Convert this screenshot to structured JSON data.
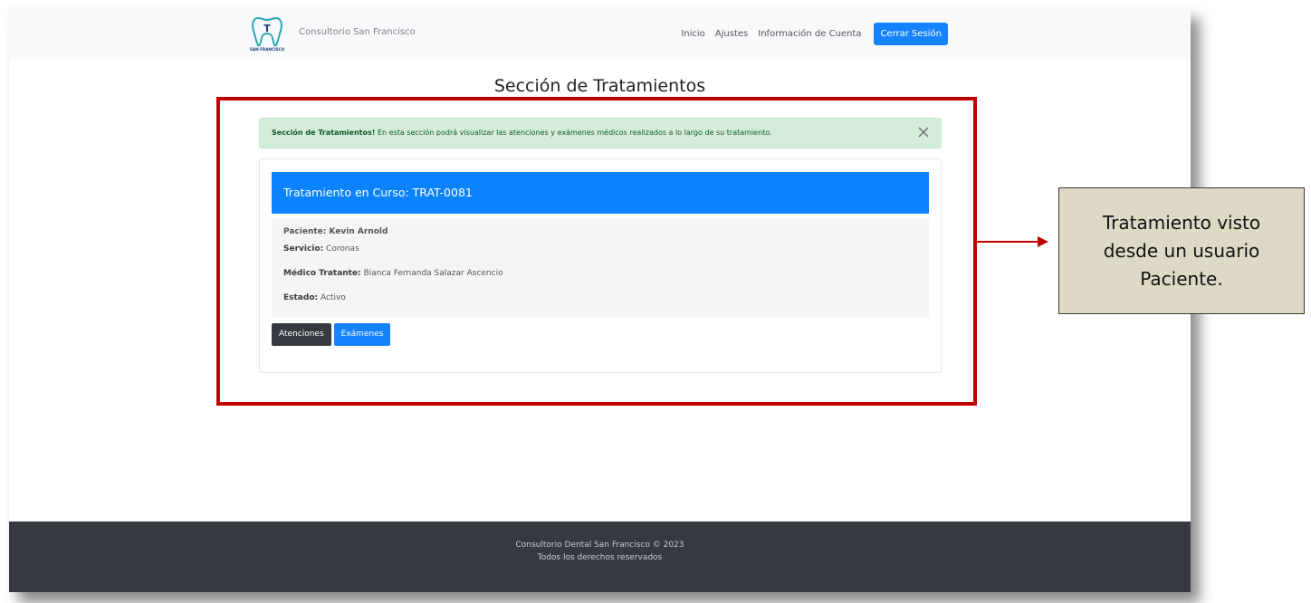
{
  "navbar": {
    "brand_name": "Consultorio San Francisco",
    "logo_text": "SAN FRANCISCO",
    "logo_letter": "T",
    "links": [
      "Inicio",
      "Ajustes",
      "Información de Cuenta"
    ],
    "logout_label": "Cerrar Sesión"
  },
  "page": {
    "title": "Sección de Tratamientos"
  },
  "alert": {
    "strong": "Sección de Tratamientos!",
    "text": " En esta sección podrá visualizar las atenciones y exámenes médicos realizados a lo largo de su tratamiento."
  },
  "card": {
    "header": "Tratamiento en Curso: TRAT-0081",
    "paciente": "Paciente: Kevin Arnold",
    "servicio_label": "Servicio:",
    "servicio_value": " Coronas",
    "medico_label": "Médico Tratante:",
    "medico_value": " Bianca Fernanda Salazar Ascencio",
    "estado_label": "Estado:",
    "estado_value": " Activo",
    "btn_atenciones": "Atenciones",
    "btn_examenes": "Exámenes"
  },
  "footer": {
    "line1": "Consultorio Dental San Francisco © 2023",
    "line2": "Todos los derechos reservados"
  },
  "annotation": {
    "callout": "Tratamiento visto desde un usuario Paciente."
  },
  "colors": {
    "primary": "#1583ff",
    "dark": "#343a40",
    "alert_bg": "#d4edda",
    "highlight": "#c00000",
    "callout_bg": "#ddd9c4"
  }
}
